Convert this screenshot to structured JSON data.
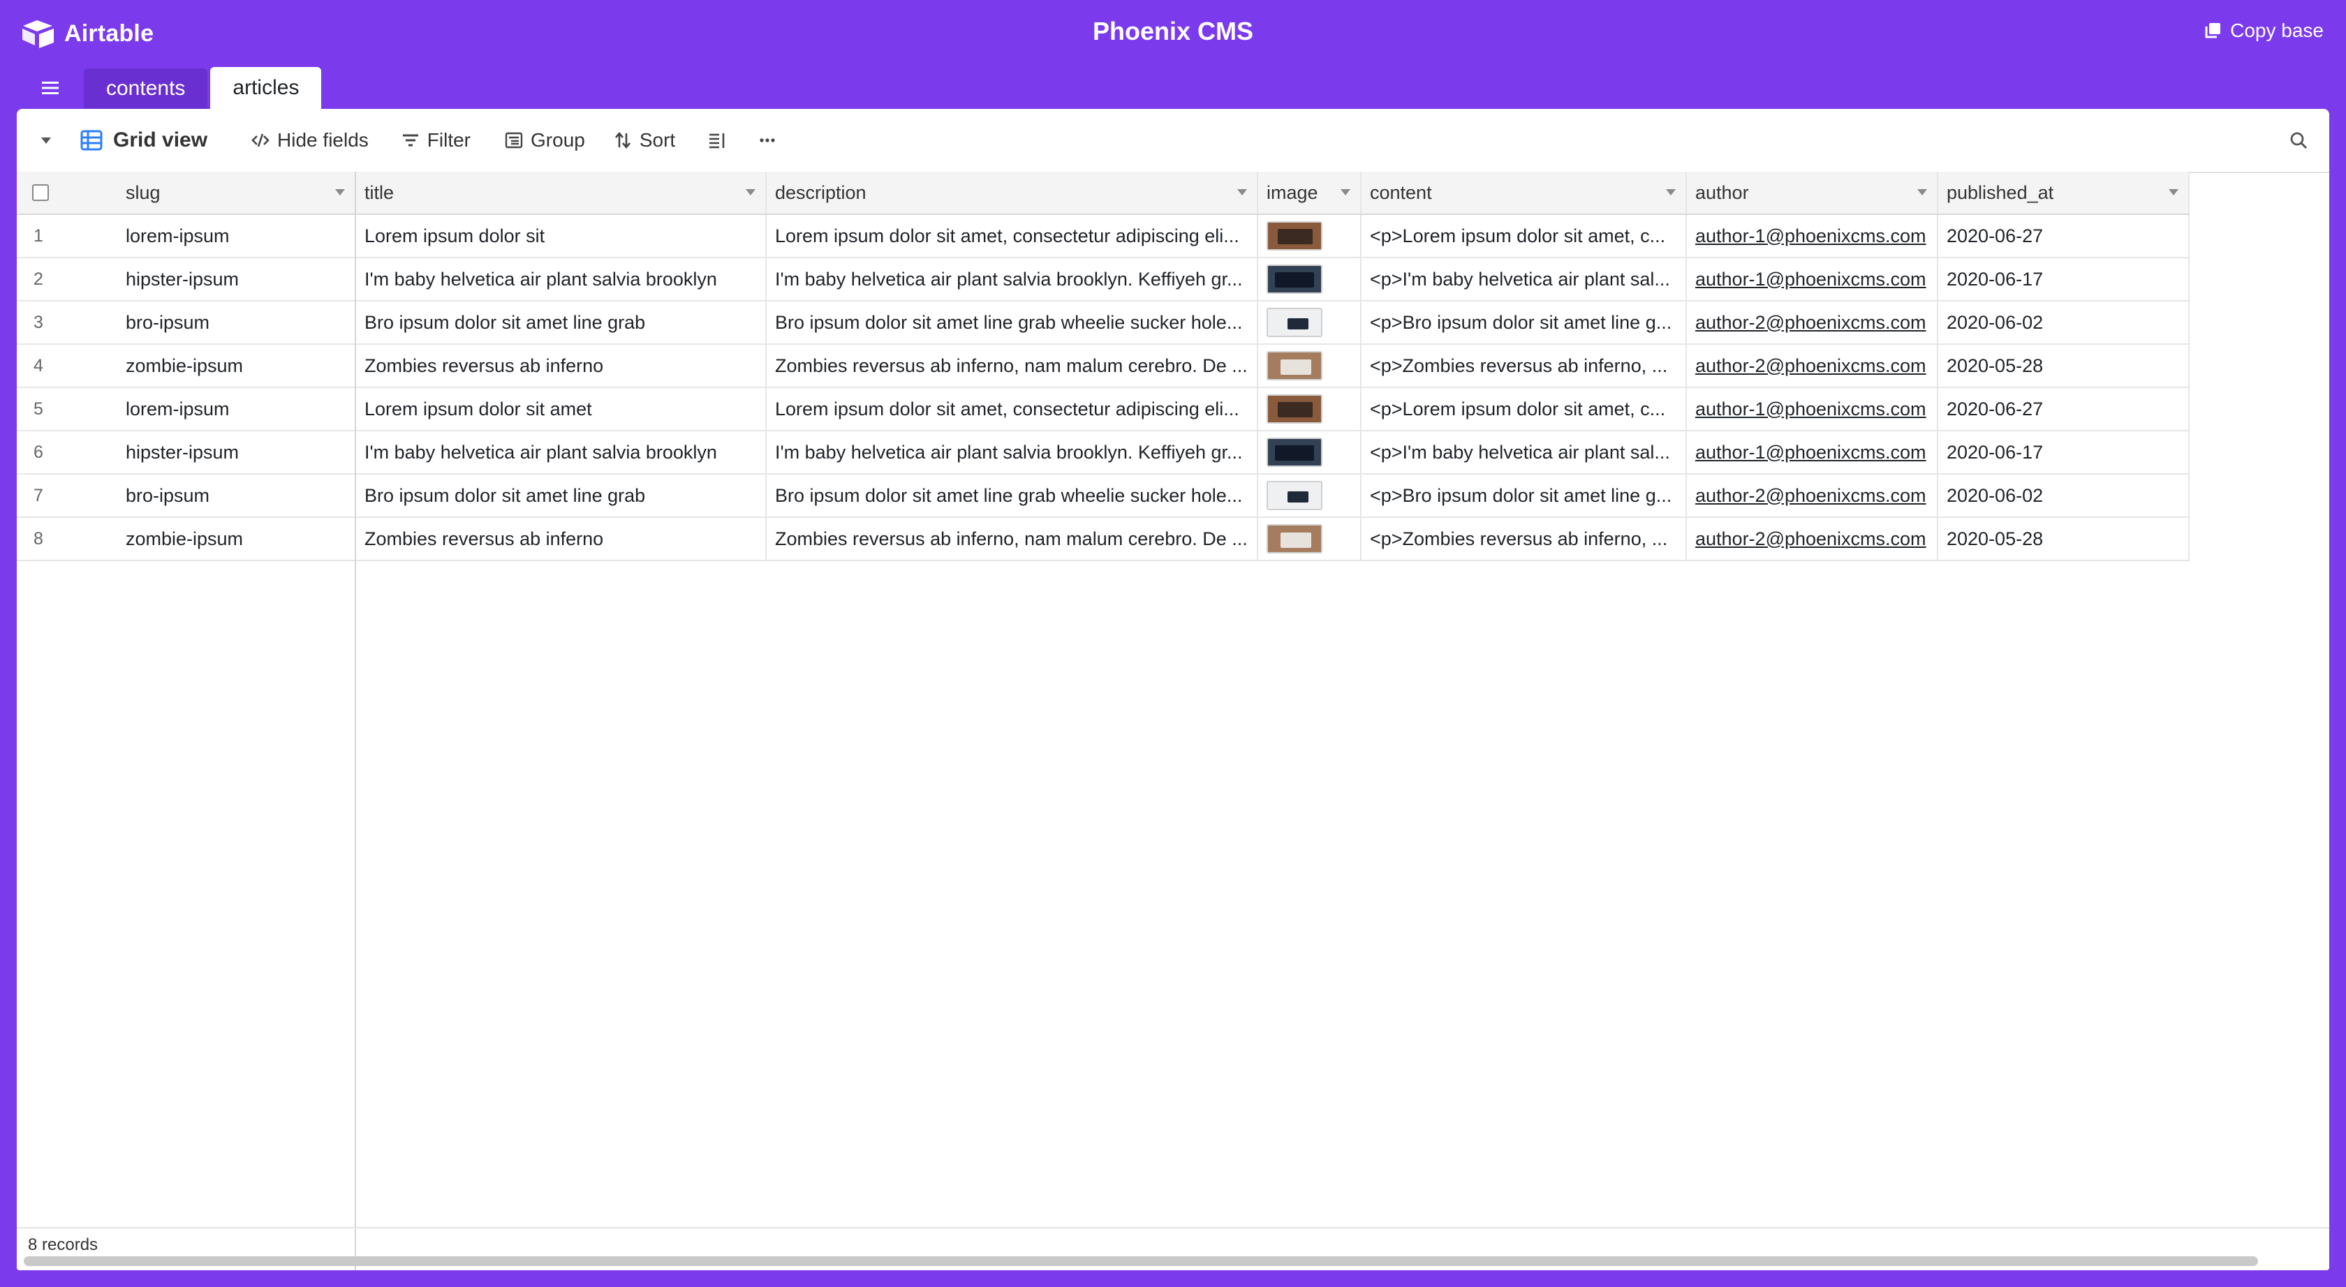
{
  "app": {
    "logo_text": "Airtable",
    "base_title": "Phoenix CMS",
    "copy_base_label": "Copy base"
  },
  "tabs": [
    {
      "label": "contents",
      "active": false
    },
    {
      "label": "articles",
      "active": true
    }
  ],
  "toolbar": {
    "view_name": "Grid view",
    "hide_fields": "Hide fields",
    "filter": "Filter",
    "group": "Group",
    "sort": "Sort"
  },
  "columns": [
    "slug",
    "title",
    "description",
    "image",
    "content",
    "author",
    "published_at"
  ],
  "rows": [
    {
      "num": "1",
      "slug": "lorem-ipsum",
      "title": "Lorem ipsum dolor sit",
      "description": "Lorem ipsum dolor sit amet, consectetur adipiscing eli...",
      "image": "desk-thumbnail",
      "content": "<p>Lorem ipsum dolor sit amet, c...",
      "author": "author-1@phoenixcms.com",
      "published_at": "2020-06-27"
    },
    {
      "num": "2",
      "slug": "hipster-ipsum",
      "title": "I'm baby helvetica air plant salvia brooklyn",
      "description": "I'm baby helvetica air plant salvia brooklyn. Keffiyeh gr...",
      "image": "dark-thumbnail",
      "content": "<p>I'm baby helvetica air plant sal...",
      "author": "author-1@phoenixcms.com",
      "published_at": "2020-06-17"
    },
    {
      "num": "3",
      "slug": "bro-ipsum",
      "title": "Bro ipsum dolor sit amet line grab",
      "description": "Bro ipsum dolor sit amet line grab wheelie sucker hole...",
      "image": "light-thumbnail",
      "content": "<p>Bro ipsum dolor sit amet line g...",
      "author": "author-2@phoenixcms.com",
      "published_at": "2020-06-02"
    },
    {
      "num": "4",
      "slug": "zombie-ipsum",
      "title": "Zombies reversus ab inferno",
      "description": "Zombies reversus ab inferno, nam malum cerebro. De ...",
      "image": "warm-thumbnail",
      "content": "<p>Zombies reversus ab inferno, ...",
      "author": "author-2@phoenixcms.com",
      "published_at": "2020-05-28"
    },
    {
      "num": "5",
      "slug": "lorem-ipsum",
      "title": "Lorem ipsum dolor sit amet",
      "description": "Lorem ipsum dolor sit amet, consectetur adipiscing eli...",
      "image": "desk-thumbnail",
      "content": "<p>Lorem ipsum dolor sit amet, c...",
      "author": "author-1@phoenixcms.com",
      "published_at": "2020-06-27"
    },
    {
      "num": "6",
      "slug": "hipster-ipsum",
      "title": "I'm baby helvetica air plant salvia brooklyn",
      "description": "I'm baby helvetica air plant salvia brooklyn. Keffiyeh gr...",
      "image": "dark-thumbnail",
      "content": "<p>I'm baby helvetica air plant sal...",
      "author": "author-1@phoenixcms.com",
      "published_at": "2020-06-17"
    },
    {
      "num": "7",
      "slug": "bro-ipsum",
      "title": "Bro ipsum dolor sit amet line grab",
      "description": "Bro ipsum dolor sit amet line grab wheelie sucker hole...",
      "image": "light-thumbnail",
      "content": "<p>Bro ipsum dolor sit amet line g...",
      "author": "author-2@phoenixcms.com",
      "published_at": "2020-06-02"
    },
    {
      "num": "8",
      "slug": "zombie-ipsum",
      "title": "Zombies reversus ab inferno",
      "description": "Zombies reversus ab inferno, nam malum cerebro. De ...",
      "image": "warm-thumbnail",
      "content": "<p>Zombies reversus ab inferno, ...",
      "author": "author-2@phoenixcms.com",
      "published_at": "2020-05-28"
    }
  ],
  "footer": {
    "records_label": "8 records"
  },
  "colors": {
    "brand": "#7c3aed",
    "grid_view_icon": "#2d7ff9"
  }
}
